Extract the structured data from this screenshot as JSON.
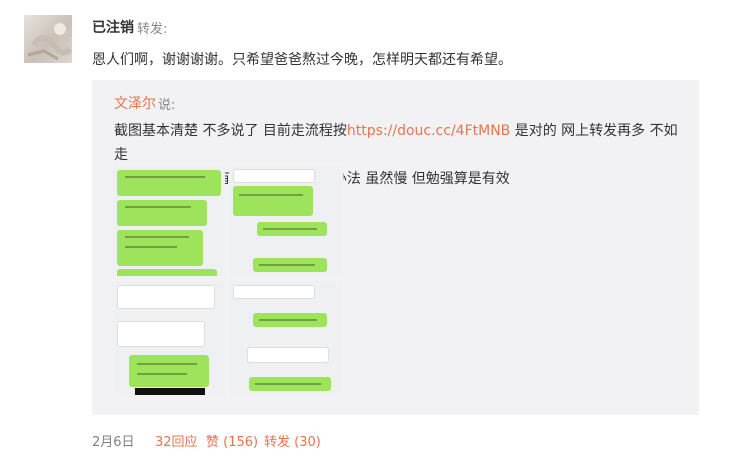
{
  "post": {
    "author": "已注销",
    "action": "转发:",
    "text": "恩人们啊，谢谢谢谢。只希望爸爸熬过今晚，怎样明天都还有希望。"
  },
  "quoted": {
    "author": "文泽尔",
    "action": "说:",
    "text_line1_prefix": "截图基本清楚 不多说了 目前走流程按",
    "link": "https://douc.cc/4FtMNB",
    "text_line1_suffix": " 是对的 网上转发再多 不如走",
    "text_line2": "对步骤 中间环节有阻碍 就一点点想办法 虽然慢 但勉强算是有效"
  },
  "footer": {
    "date": "2月6日",
    "comments": "32回应",
    "likes": "赞 (156)",
    "reposts": "转发 (30)"
  },
  "colors": {
    "accent": "#eb7350",
    "quote_bg": "#f2f2f5",
    "bubble_green": "#9de35c"
  }
}
